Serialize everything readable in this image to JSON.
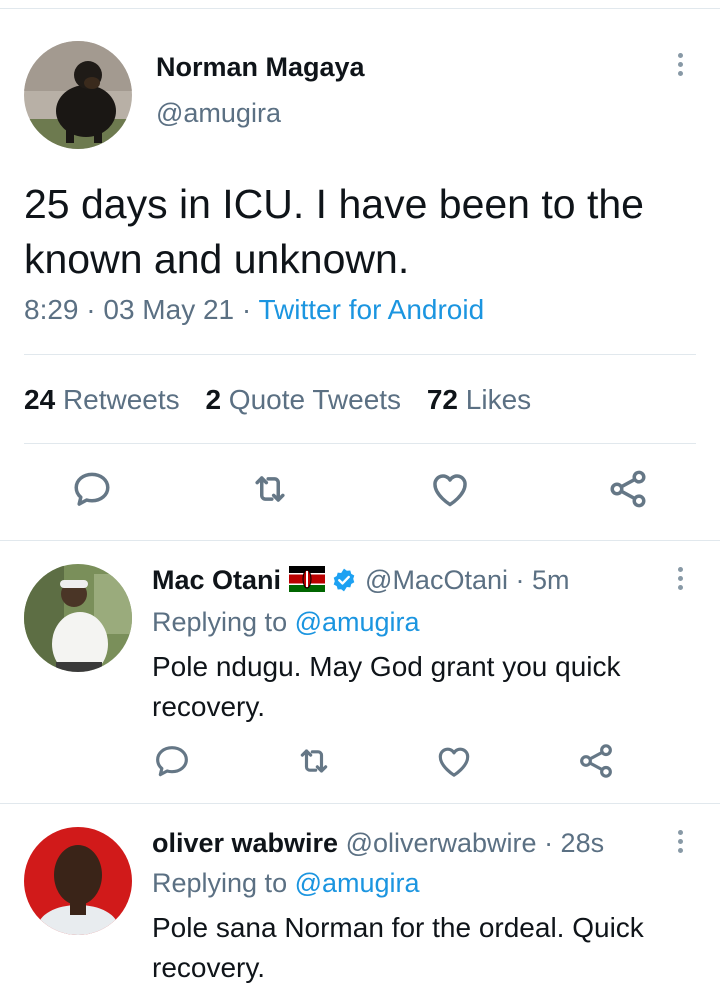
{
  "main_tweet": {
    "author_name": "Norman Magaya",
    "author_handle": "@amugira",
    "text": "25 days in ICU. I have been to the known and unknown.",
    "time": "8:29 · 03 May 21 · ",
    "source": "Twitter for Android",
    "stats": {
      "retweets_count": "24",
      "retweets_label": "Retweets",
      "quotes_count": "2",
      "quotes_label": "Quote Tweets",
      "likes_count": "72",
      "likes_label": "Likes"
    }
  },
  "replies": [
    {
      "author_name": "Mac Otani",
      "author_handle": "@MacOtani",
      "age": " · 5m",
      "replying_prefix": "Replying to ",
      "replying_to": "@amugira",
      "text": "Pole ndugu. May God grant you quick recovery.",
      "verified": true,
      "flag": "kenya-flag-emoji"
    },
    {
      "author_name": "oliver wabwire",
      "author_handle": "@oliverwabwire",
      "age": " · 28s",
      "replying_prefix": "Replying to ",
      "replying_to": "@amugira",
      "text": "Pole sana Norman for the ordeal. Quick recovery."
    }
  ],
  "icons": [
    "reply-icon",
    "retweet-icon",
    "like-icon",
    "share-icon",
    "more-icon",
    "verified-icon"
  ],
  "colors": {
    "link": "#1b95e0",
    "secondary_text": "#5b7083",
    "divider": "#e1e8ed",
    "icon": "#657786",
    "verified": "#1da1f2"
  }
}
